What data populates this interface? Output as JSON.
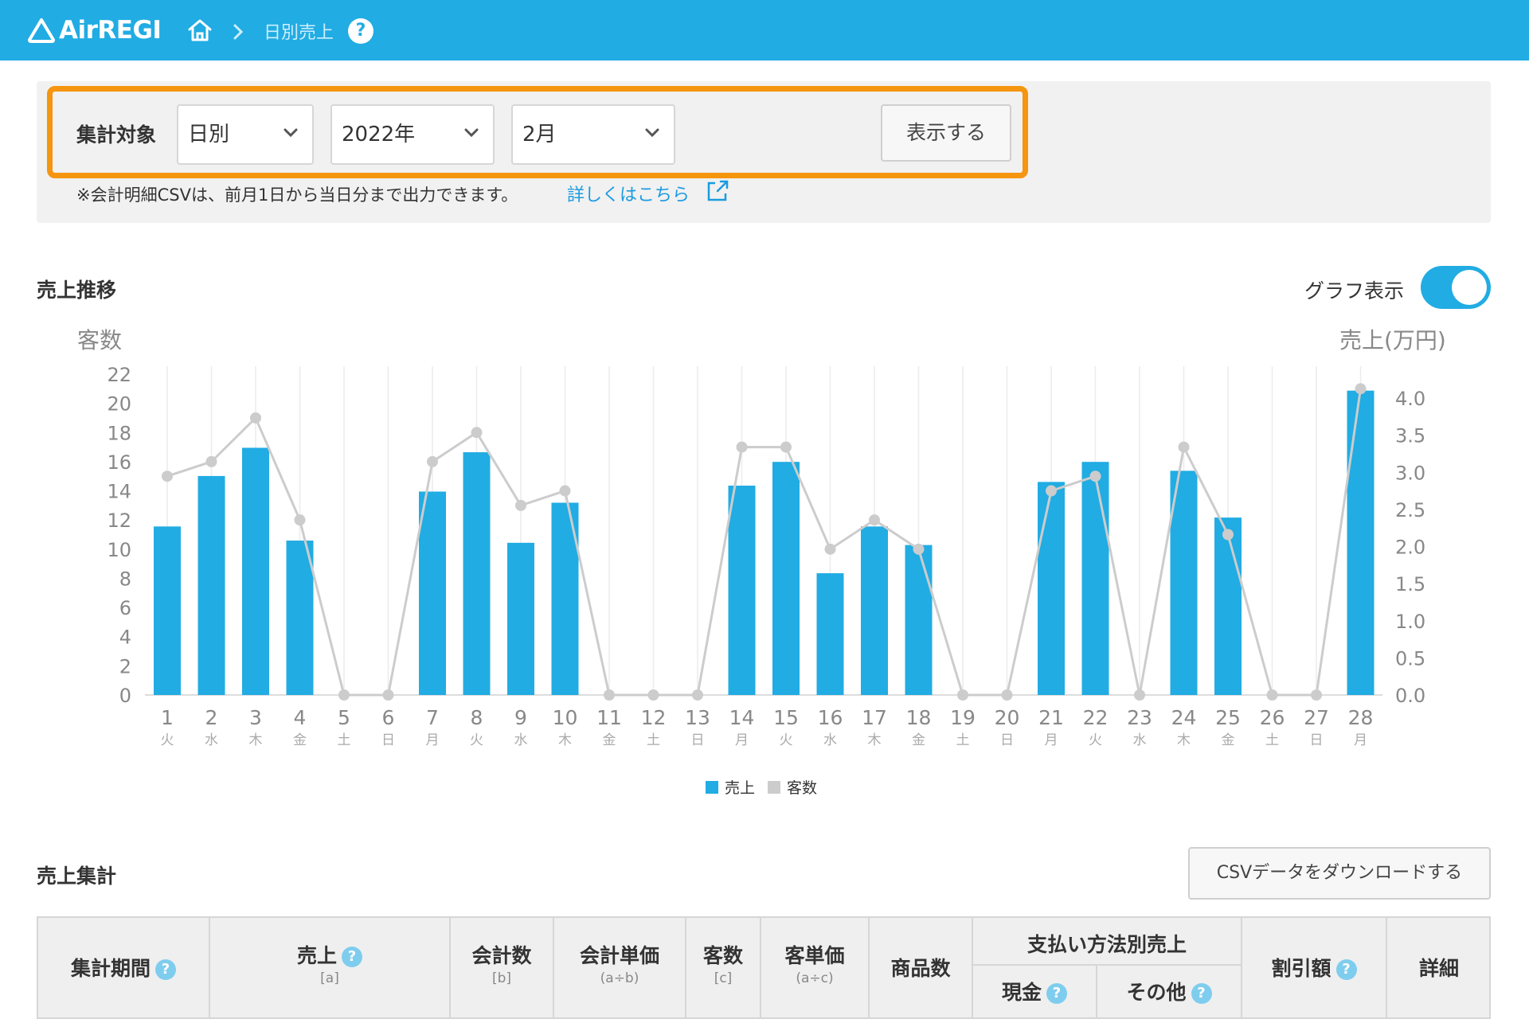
{
  "header": {
    "logo_text": "AirREGI",
    "breadcrumb_current": "日別売上",
    "help_label": "?"
  },
  "filter": {
    "label": "集計対象",
    "period_type": "日別",
    "year": "2022年",
    "month": "2月",
    "show_button": "表示する",
    "note": "※会計明細CSVは、前月1日から当日分まで出力できます。",
    "note_link": "詳しくはこちら"
  },
  "chart_section": {
    "title": "売上推移",
    "toggle_label": "グラフ表示",
    "toggle_on": true
  },
  "chart_data": {
    "type": "bar",
    "left_axis_label": "客数",
    "right_axis_label": "売上(万円)",
    "left_ticks": [
      "0",
      "2",
      "4",
      "6",
      "8",
      "10",
      "12",
      "14",
      "16",
      "18",
      "20",
      "22"
    ],
    "right_ticks": [
      "0.0",
      "0.5",
      "1.0",
      "1.5",
      "2.0",
      "2.5",
      "3.0",
      "3.5",
      "4.0"
    ],
    "left_ylim": [
      0,
      22
    ],
    "right_ylim": [
      0,
      4.35
    ],
    "days": [
      "1",
      "2",
      "3",
      "4",
      "5",
      "6",
      "7",
      "8",
      "9",
      "10",
      "11",
      "12",
      "13",
      "14",
      "15",
      "16",
      "17",
      "18",
      "19",
      "20",
      "21",
      "22",
      "23",
      "24",
      "25",
      "26",
      "27",
      "28"
    ],
    "weekdays": [
      "火",
      "水",
      "木",
      "金",
      "土",
      "日",
      "月",
      "火",
      "水",
      "木",
      "金",
      "土",
      "日",
      "月",
      "火",
      "水",
      "木",
      "金",
      "土",
      "日",
      "月",
      "火",
      "水",
      "木",
      "金",
      "土",
      "日",
      "月"
    ],
    "series": [
      {
        "name": "売上",
        "color": "#21ace3",
        "values": [
          2.27,
          2.95,
          3.33,
          2.08,
          0,
          0,
          2.74,
          3.27,
          2.05,
          2.59,
          0,
          0,
          0,
          2.82,
          3.14,
          1.64,
          2.27,
          2.02,
          0,
          0,
          2.87,
          3.14,
          0,
          3.02,
          2.39,
          0,
          0,
          4.1
        ]
      },
      {
        "name": "客数",
        "color": "#cccccc",
        "values": [
          15,
          16,
          19,
          12,
          0,
          0,
          16,
          18,
          13,
          14,
          0,
          0,
          0,
          17,
          17,
          10,
          12,
          10,
          0,
          0,
          14,
          15,
          0,
          17,
          11,
          0,
          0,
          21
        ]
      }
    ],
    "legend": [
      "売上",
      "客数"
    ],
    "legend_position": "bottom-center",
    "grid": true
  },
  "summary_section": {
    "title": "売上集計",
    "csv_button": "CSVデータをダウンロードする"
  },
  "table": {
    "headers": {
      "period": "集計期間",
      "sales": "売上",
      "sales_sub": "[a]",
      "count": "会計数",
      "count_sub": "[b]",
      "unit_price": "会計単価",
      "unit_price_sub": "(a÷b)",
      "customers": "客数",
      "customers_sub": "[c]",
      "customer_price": "客単価",
      "customer_price_sub": "(a÷c)",
      "items": "商品数",
      "payment_group": "支払い方法別売上",
      "cash": "現金",
      "other": "その他",
      "discount": "割引額",
      "detail": "詳細"
    }
  }
}
